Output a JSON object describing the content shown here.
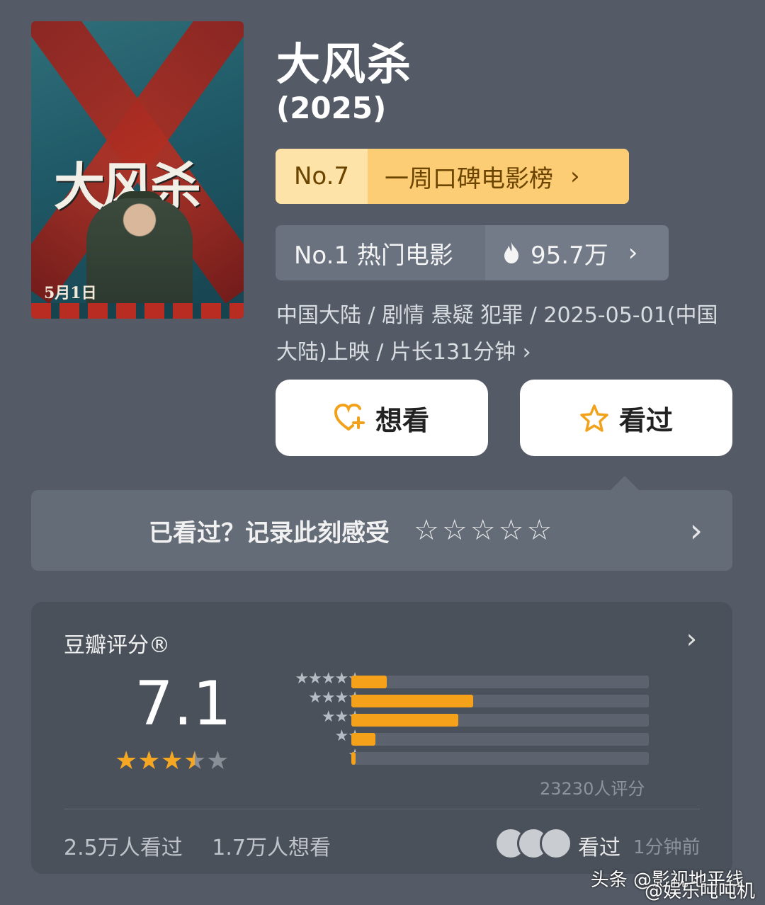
{
  "poster": {
    "title_text": "大风杀",
    "date_text": "5月1日"
  },
  "movie": {
    "title": "大风杀",
    "year": "(2025)"
  },
  "rank_weekly": {
    "number": "No.7",
    "label": "一周口碑电影榜",
    "chevron": "›"
  },
  "rank_hot": {
    "number_label": "No.1 热门电影",
    "heat_icon": "flame-icon",
    "heat_value": "95.7万",
    "chevron": "›"
  },
  "info_line": "中国大陆 / 剧情 悬疑 犯罪 / 2025-05-01(中国大陆)上映 / 片长131分钟 ›",
  "buttons": {
    "want": {
      "icon": "heart-plus-icon",
      "label": "想看"
    },
    "seen": {
      "icon": "star-outline-icon",
      "label": "看过"
    }
  },
  "record": {
    "text": "已看过？记录此刻感受",
    "stars": "☆☆☆☆☆",
    "chevron": "›"
  },
  "rating_card": {
    "label": "豆瓣评分®",
    "chevron": "›",
    "score": "7.1",
    "star_rating": 3.5,
    "histogram": [
      {
        "stars": "★★★★★",
        "fraction": 0.12
      },
      {
        "stars": "★★★★",
        "fraction": 0.41
      },
      {
        "stars": "★★★",
        "fraction": 0.36
      },
      {
        "stars": "★★",
        "fraction": 0.08
      },
      {
        "stars": "★",
        "fraction": 0.01
      }
    ],
    "votes": "23230人评分",
    "seen_count": "2.5万人看过",
    "want_count": "1.7万人想看",
    "recent_label": "看过",
    "recent_time": "1分钟前"
  },
  "watermarks": {
    "line1": "头条 @影视地平线",
    "line2": "@娱乐吨吨机"
  },
  "colors": {
    "background": "#545b66",
    "accent": "#f5a623",
    "rank_bg": "#fccd75"
  }
}
